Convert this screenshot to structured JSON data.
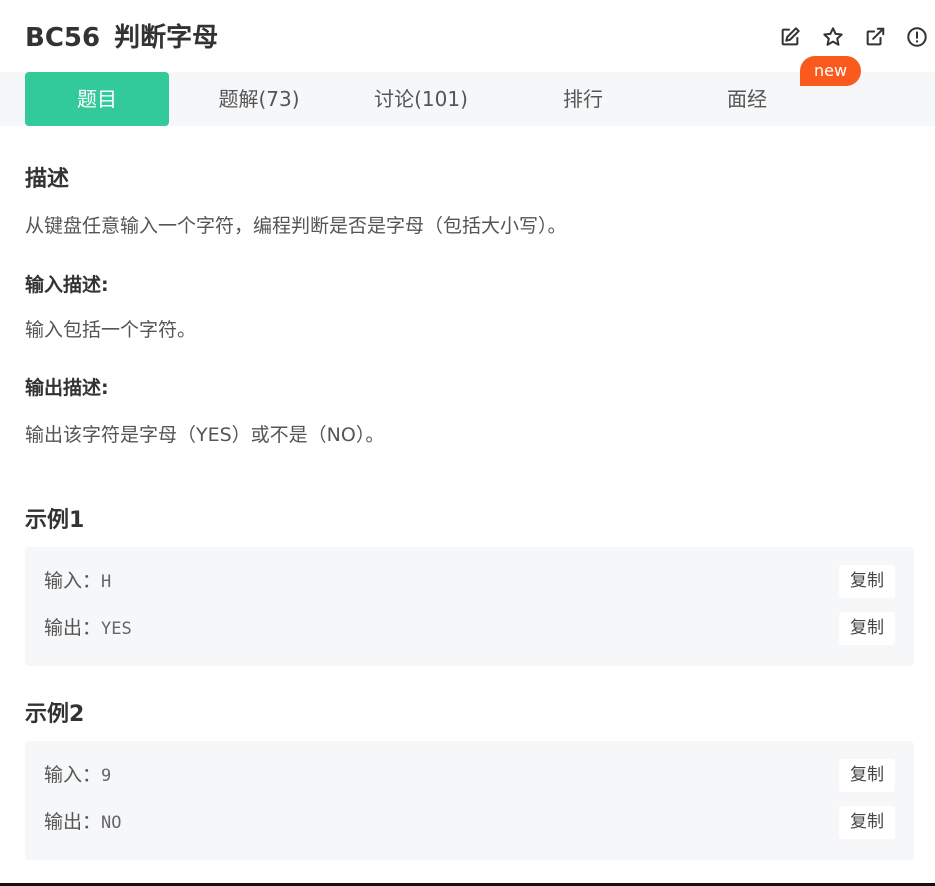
{
  "header": {
    "problem_code": "BC56",
    "problem_title": "判断字母",
    "icons": [
      "edit-icon",
      "star-icon",
      "external-link-icon",
      "report-icon"
    ]
  },
  "tabs": [
    {
      "label": "题目",
      "active": true
    },
    {
      "label": "题解(73)",
      "active": false
    },
    {
      "label": "讨论(101)",
      "active": false
    },
    {
      "label": "排行",
      "active": false
    },
    {
      "label": "面经",
      "active": false
    }
  ],
  "new_badge": "new",
  "description": {
    "heading": "描述",
    "text": "从键盘任意输入一个字符，编程判断是否是字母（包括大小写）。"
  },
  "input_desc": {
    "heading": "输入描述:",
    "text": "输入包括一个字符。"
  },
  "output_desc": {
    "heading": "输出描述:",
    "text": "输出该字符是字母（YES）或不是（NO）。"
  },
  "examples": [
    {
      "heading": "示例1",
      "input_label": "输入：",
      "input_value": "H",
      "output_label": "输出：",
      "output_value": "YES",
      "copy_label": "复制"
    },
    {
      "heading": "示例2",
      "input_label": "输入：",
      "input_value": "9",
      "output_label": "输出：",
      "output_value": "NO",
      "copy_label": "复制"
    }
  ],
  "colors": {
    "accent": "#32ca99",
    "badge": "#fa5a1e",
    "tabs_bg": "#f6f7f8"
  }
}
